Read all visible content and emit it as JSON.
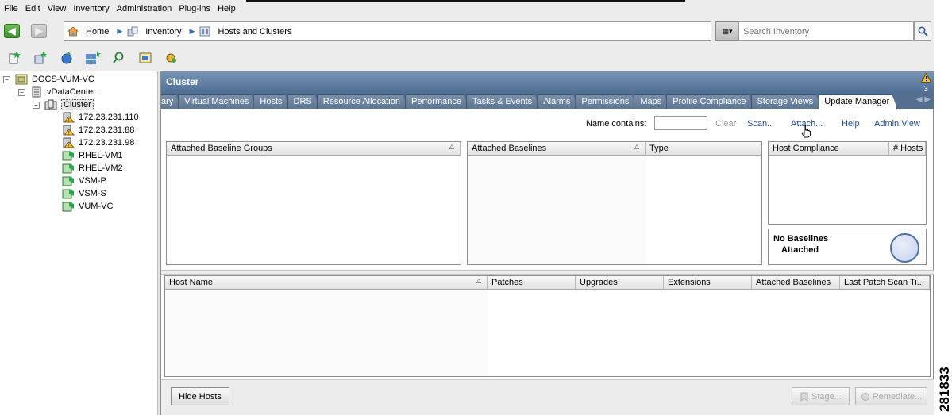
{
  "menu": {
    "items": [
      "File",
      "Edit",
      "View",
      "Inventory",
      "Administration",
      "Plug-ins",
      "Help"
    ]
  },
  "nav": {
    "breadcrumb": [
      "Home",
      "Inventory",
      "Hosts and Clusters"
    ],
    "search_placeholder": "Search Inventory"
  },
  "toolbar": {
    "icons": [
      "new-vm-icon",
      "new-host-icon",
      "refresh-icon",
      "new-cluster-icon",
      "search-icon",
      "console-icon",
      "tools-icon"
    ]
  },
  "tree": {
    "vcenter": "DOCS-VUM-VC",
    "datacenter": "vDataCenter",
    "cluster": "Cluster",
    "hosts": [
      "172.23.231.110",
      "172.23.231.88",
      "172.23.231.98"
    ],
    "vms": [
      "RHEL-VM1",
      "RHEL-VM2",
      "VSM-P",
      "VSM-S",
      "VUM-VC"
    ]
  },
  "main": {
    "title": "Cluster",
    "alarm_count": "3",
    "tabs": [
      "ary",
      "Virtual Machines",
      "Hosts",
      "DRS",
      "Resource Allocation",
      "Performance",
      "Tasks & Events",
      "Alarms",
      "Permissions",
      "Maps",
      "Profile Compliance",
      "Storage Views",
      "Update Manager"
    ],
    "active_tab": "Update Manager",
    "filter": {
      "label": "Name contains:",
      "value": "",
      "clear": "Clear",
      "scan": "Scan...",
      "attach": "Attach...",
      "help": "Help",
      "admin_view": "Admin View"
    },
    "baseline_groups_header": "Attached Baseline Groups",
    "baselines_headers": [
      "Attached Baselines",
      "Type"
    ],
    "compliance_headers": [
      "Host Compliance",
      "# Hosts"
    ],
    "no_baselines": [
      "No Baselines",
      "Attached"
    ],
    "hosts_headers": [
      "Host Name",
      "Patches",
      "Upgrades",
      "Extensions",
      "Attached Baselines",
      "Last Patch Scan Ti..."
    ],
    "buttons": {
      "hide_hosts": "Hide Hosts",
      "stage": "Stage...",
      "remediate": "Remediate..."
    }
  },
  "figure_number": "281833",
  "colors": {
    "header_blue": "#5b7aa0",
    "link_blue": "#1f4b9a",
    "disabled_gray": "#a8a8a8"
  }
}
